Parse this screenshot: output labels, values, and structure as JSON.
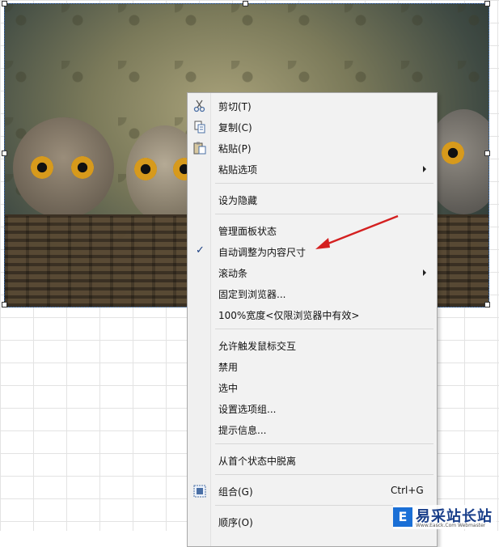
{
  "menu": {
    "items": [
      {
        "label": "剪切(T)",
        "icon": "scissors-icon"
      },
      {
        "label": "复制(C)",
        "icon": "copy-icon"
      },
      {
        "label": "粘贴(P)",
        "icon": "paste-icon"
      },
      {
        "label": "粘贴选项",
        "submenu": true
      },
      {
        "label": "设为隐藏"
      },
      {
        "label": "管理面板状态"
      },
      {
        "label": "自动调整为内容尺寸",
        "checked": true
      },
      {
        "label": "滚动条",
        "submenu": true
      },
      {
        "label": "固定到浏览器..."
      },
      {
        "label": "100%宽度<仅限浏览器中有效>"
      },
      {
        "label": "允许触发鼠标交互"
      },
      {
        "label": "禁用"
      },
      {
        "label": "选中"
      },
      {
        "label": "设置选项组..."
      },
      {
        "label": "提示信息..."
      },
      {
        "label": "从首个状态中脱离"
      },
      {
        "label": "组合(G)",
        "shortcut": "Ctrl+G",
        "icon": "group-icon"
      },
      {
        "label": "顺序(O)"
      }
    ],
    "check_mark": "✓"
  },
  "colors": {
    "annotation_arrow": "#d42020",
    "check": "#1b3f82"
  },
  "watermark": {
    "logo_letter": "E",
    "title": "易采站长站",
    "subtitle": "Www.Easck.Com Webmaster"
  }
}
